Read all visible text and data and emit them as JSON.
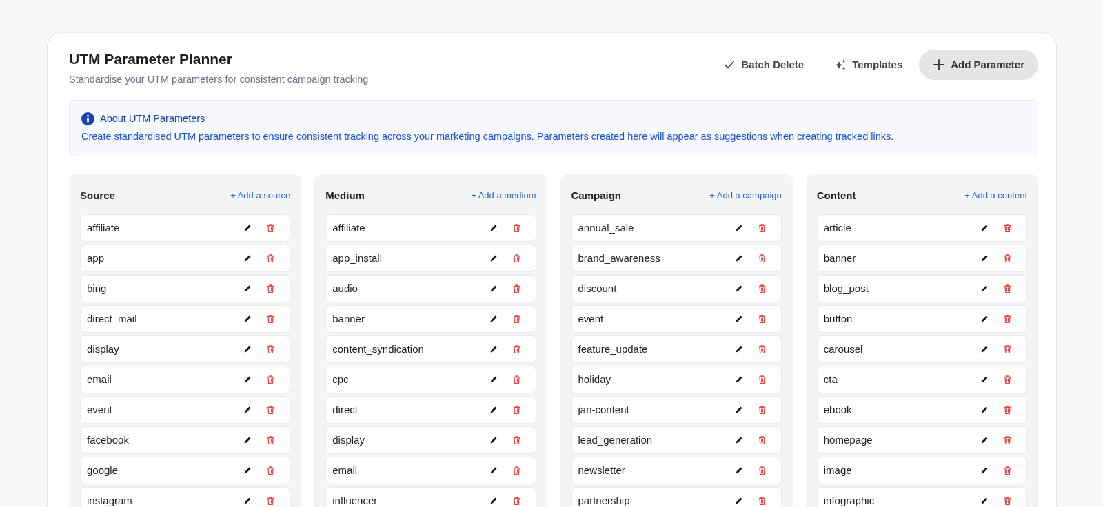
{
  "header": {
    "title": "UTM Parameter Planner",
    "subtitle": "Standardise your UTM parameters for consistent campaign tracking"
  },
  "actions": [
    {
      "kind": "check",
      "label": "Batch Delete"
    },
    {
      "kind": "sparkle",
      "label": "Templates"
    },
    {
      "kind": "plus",
      "label": "Add Parameter",
      "primary": true
    }
  ],
  "info": {
    "title": "About UTM Parameters",
    "text": "Create standardised UTM parameters to ensure consistent tracking across your marketing campaigns. Parameters created here will appear as suggestions when creating tracked links."
  },
  "columns": [
    {
      "title": "Source",
      "add_link": "+ Add a source",
      "items": [
        "affiliate",
        "app",
        "bing",
        "direct_mail",
        "display",
        "email",
        "event",
        "facebook",
        "google",
        "instagram"
      ]
    },
    {
      "title": "Medium",
      "add_link": "+ Add a medium",
      "items": [
        "affiliate",
        "app_install",
        "audio",
        "banner",
        "content_syndication",
        "cpc",
        "direct",
        "display",
        "email",
        "influencer"
      ]
    },
    {
      "title": "Campaign",
      "add_link": "+ Add a campaign",
      "items": [
        "annual_sale",
        "brand_awareness",
        "discount",
        "event",
        "feature_update",
        "holiday",
        "jan-content",
        "lead_generation",
        "newsletter",
        "partnership"
      ]
    },
    {
      "title": "Content",
      "add_link": "+ Add a content",
      "items": [
        "article",
        "banner",
        "blog_post",
        "button",
        "carousel",
        "cta",
        "ebook",
        "homepage",
        "image",
        "infographic"
      ]
    }
  ]
}
